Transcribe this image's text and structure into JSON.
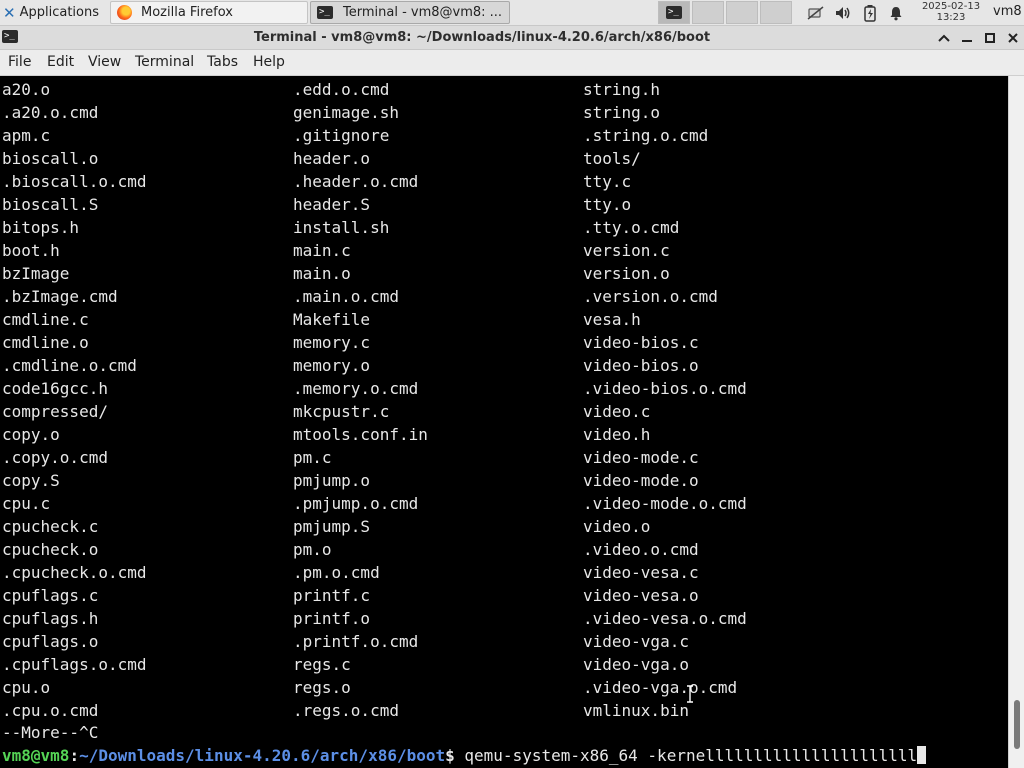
{
  "panel": {
    "applications_label": "Applications",
    "tasks": [
      {
        "label": "Mozilla Firefox",
        "icon": "firefox-icon"
      },
      {
        "label": "Terminal - vm8@vm8: ...",
        "icon": "terminal-icon"
      }
    ],
    "workspaces": [
      "1",
      "2",
      "3",
      "4"
    ],
    "clock": {
      "date": "2025-02-13",
      "time": "13:23"
    },
    "user": "vm8"
  },
  "window": {
    "title": "Terminal - vm8@vm8: ~/Downloads/linux-4.20.6/arch/x86/boot"
  },
  "menubar": {
    "file": "File",
    "edit": "Edit",
    "view": "View",
    "terminal": "Terminal",
    "tabs": "Tabs",
    "help": "Help"
  },
  "terminal": {
    "listing": [
      [
        "a20.o",
        ".edd.o.cmd",
        "string.h"
      ],
      [
        ".a20.o.cmd",
        "genimage.sh",
        "string.o"
      ],
      [
        "apm.c",
        ".gitignore",
        ".string.o.cmd"
      ],
      [
        "bioscall.o",
        "header.o",
        "tools/"
      ],
      [
        ".bioscall.o.cmd",
        ".header.o.cmd",
        "tty.c"
      ],
      [
        "bioscall.S",
        "header.S",
        "tty.o"
      ],
      [
        "bitops.h",
        "install.sh",
        ".tty.o.cmd"
      ],
      [
        "boot.h",
        "main.c",
        "version.c"
      ],
      [
        "bzImage",
        "main.o",
        "version.o"
      ],
      [
        ".bzImage.cmd",
        ".main.o.cmd",
        ".version.o.cmd"
      ],
      [
        "cmdline.c",
        "Makefile",
        "vesa.h"
      ],
      [
        "cmdline.o",
        "memory.c",
        "video-bios.c"
      ],
      [
        ".cmdline.o.cmd",
        "memory.o",
        "video-bios.o"
      ],
      [
        "code16gcc.h",
        ".memory.o.cmd",
        ".video-bios.o.cmd"
      ],
      [
        "compressed/",
        "mkcpustr.c",
        "video.c"
      ],
      [
        "copy.o",
        "mtools.conf.in",
        "video.h"
      ],
      [
        ".copy.o.cmd",
        "pm.c",
        "video-mode.c"
      ],
      [
        "copy.S",
        "pmjump.o",
        "video-mode.o"
      ],
      [
        "cpu.c",
        ".pmjump.o.cmd",
        ".video-mode.o.cmd"
      ],
      [
        "cpucheck.c",
        "pmjump.S",
        "video.o"
      ],
      [
        "cpucheck.o",
        "pm.o",
        ".video.o.cmd"
      ],
      [
        ".cpucheck.o.cmd",
        ".pm.o.cmd",
        "video-vesa.c"
      ],
      [
        "cpuflags.c",
        "printf.c",
        "video-vesa.o"
      ],
      [
        "cpuflags.h",
        "printf.o",
        ".video-vesa.o.cmd"
      ],
      [
        "cpuflags.o",
        ".printf.o.cmd",
        "video-vga.c"
      ],
      [
        ".cpuflags.o.cmd",
        "regs.c",
        "video-vga.o"
      ],
      [
        "cpu.o",
        "regs.o",
        ".video-vga.o.cmd"
      ],
      [
        ".cpu.o.cmd",
        ".regs.o.cmd",
        "vmlinux.bin"
      ]
    ],
    "more_line": "--More--^C",
    "prompt": {
      "user_host": "vm8@vm8",
      "separator": ":",
      "path": "~/Downloads/linux-4.20.6/arch/x86/boot",
      "symbol": "$",
      "command": " qemu-system-x86_64 -kernellllllllllllllllllllll"
    }
  },
  "scrollbar": {
    "position_fraction": 0.97,
    "visible_fraction": 0.07
  },
  "colors": {
    "terminal_bg": "#000000",
    "terminal_fg": "#e8e8e8",
    "prompt_user": "#55d455",
    "prompt_path": "#5c8fe6"
  }
}
